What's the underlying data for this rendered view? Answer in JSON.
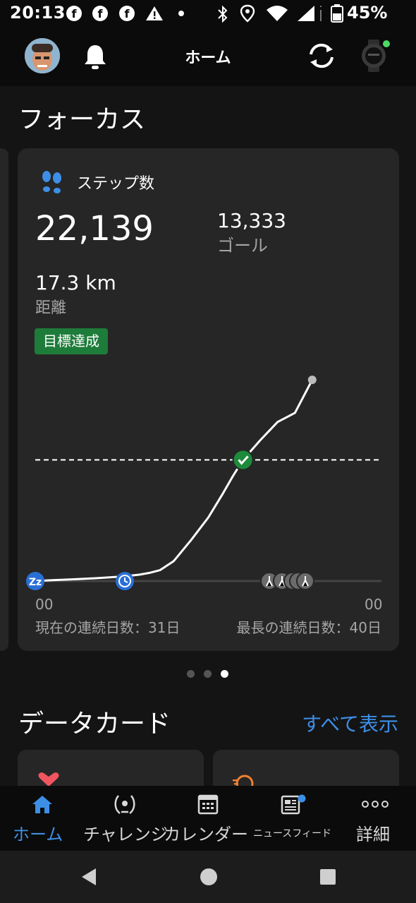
{
  "status_bar": {
    "time": "20:13",
    "battery": "45%",
    "icons": [
      "facebook-icon",
      "facebook-icon",
      "facebook-icon",
      "warning-icon",
      "dot-icon",
      "bluetooth-icon",
      "location-icon",
      "wifi-icon",
      "signal-icon",
      "battery-icon"
    ]
  },
  "header": {
    "title": "ホーム",
    "icons": [
      "avatar",
      "bell-icon",
      "sync-icon",
      "watch-icon"
    ],
    "watch_connected_color": "#4cd964"
  },
  "focus": {
    "title": "フォーカス",
    "card": {
      "steps_label": "ステップ数",
      "steps_value": "22,139",
      "goal_value": "13,333",
      "goal_label": "ゴール",
      "distance_value": "17.3 km",
      "distance_label": "距離",
      "badge": "目標達成",
      "streak_current": "現在の連続日数：31日",
      "streak_longest": "最長の連続日数：40日"
    },
    "pager": {
      "count": 3,
      "active": 2
    }
  },
  "chart_data": {
    "type": "line",
    "series": [
      {
        "values": [
          [
            0,
            0
          ],
          [
            5,
            100
          ],
          [
            10,
            180
          ],
          [
            17,
            300
          ],
          [
            25,
            500
          ],
          [
            30,
            700
          ],
          [
            33,
            900
          ],
          [
            36,
            1200
          ],
          [
            40,
            2200
          ],
          [
            45,
            4500
          ],
          [
            50,
            7000
          ],
          [
            54,
            9500
          ],
          [
            57,
            11500
          ],
          [
            60,
            13333
          ],
          [
            65,
            15500
          ],
          [
            70,
            17500
          ],
          [
            75,
            18500
          ],
          [
            80,
            22139
          ]
        ]
      }
    ],
    "goal": 13333,
    "x_tick_labels": [
      "00",
      "00"
    ],
    "markers": [
      "sleep-icon",
      "clock-icon",
      "walk-icon",
      "walk-icon",
      "walk-icon",
      "walk-icon",
      "walk-icon",
      "goal-check-icon"
    ],
    "colors": {
      "line": "#ffffff",
      "goal_line": "#ffffff",
      "check": "#1e8a3c",
      "sleep": "#2a6fd6",
      "marker": "#6b6b6b"
    }
  },
  "data_cards": {
    "title": "データカード",
    "show_all": "すべて表示",
    "card_icons": [
      "heart-icon",
      "activity-icon"
    ]
  },
  "bottom_nav": {
    "items": [
      {
        "label": "ホーム",
        "icon": "home-icon",
        "active": true
      },
      {
        "label": "チャレンジ",
        "icon": "laurel-icon"
      },
      {
        "label": "カレンダー",
        "icon": "calendar-icon"
      },
      {
        "label": "ニュースフィード",
        "icon": "news-icon"
      },
      {
        "label": "詳細",
        "icon": "more-icon"
      }
    ],
    "active_color": "#3d8fe6"
  },
  "system_nav": {
    "icons": [
      "back-icon",
      "home-circle-icon",
      "recents-icon"
    ]
  }
}
